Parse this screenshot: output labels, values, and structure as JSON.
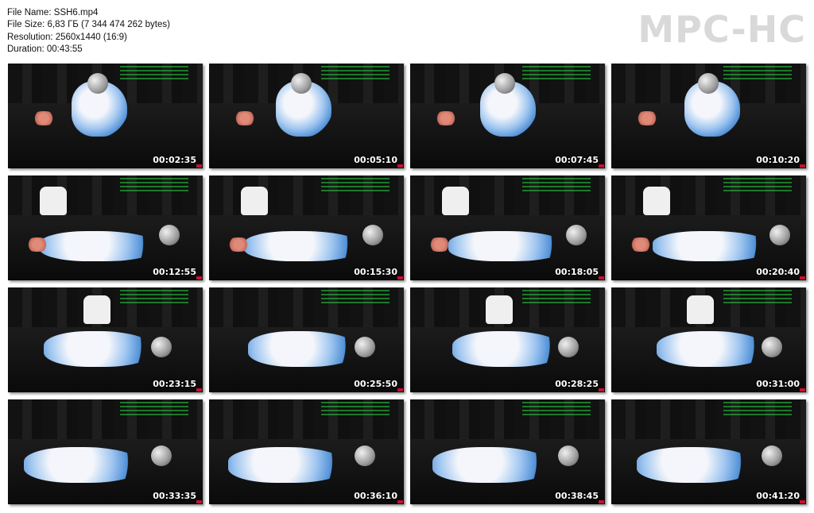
{
  "file_info": {
    "name": "File Name: SSH6.mp4",
    "size": "File Size: 6,83 ГБ (7 344 474 262 bytes)",
    "resolution": "Resolution: 2560x1440 (16:9)",
    "duration": "Duration: 00:43:55"
  },
  "logo": "MPC-HC",
  "thumbnails": [
    {
      "timestamp": "00:02:35"
    },
    {
      "timestamp": "00:05:10"
    },
    {
      "timestamp": "00:07:45"
    },
    {
      "timestamp": "00:10:20"
    },
    {
      "timestamp": "00:12:55"
    },
    {
      "timestamp": "00:15:30"
    },
    {
      "timestamp": "00:18:05"
    },
    {
      "timestamp": "00:20:40"
    },
    {
      "timestamp": "00:23:15"
    },
    {
      "timestamp": "00:25:50"
    },
    {
      "timestamp": "00:28:25"
    },
    {
      "timestamp": "00:31:00"
    },
    {
      "timestamp": "00:33:35"
    },
    {
      "timestamp": "00:36:10"
    },
    {
      "timestamp": "00:38:45"
    },
    {
      "timestamp": "00:41:20"
    }
  ]
}
